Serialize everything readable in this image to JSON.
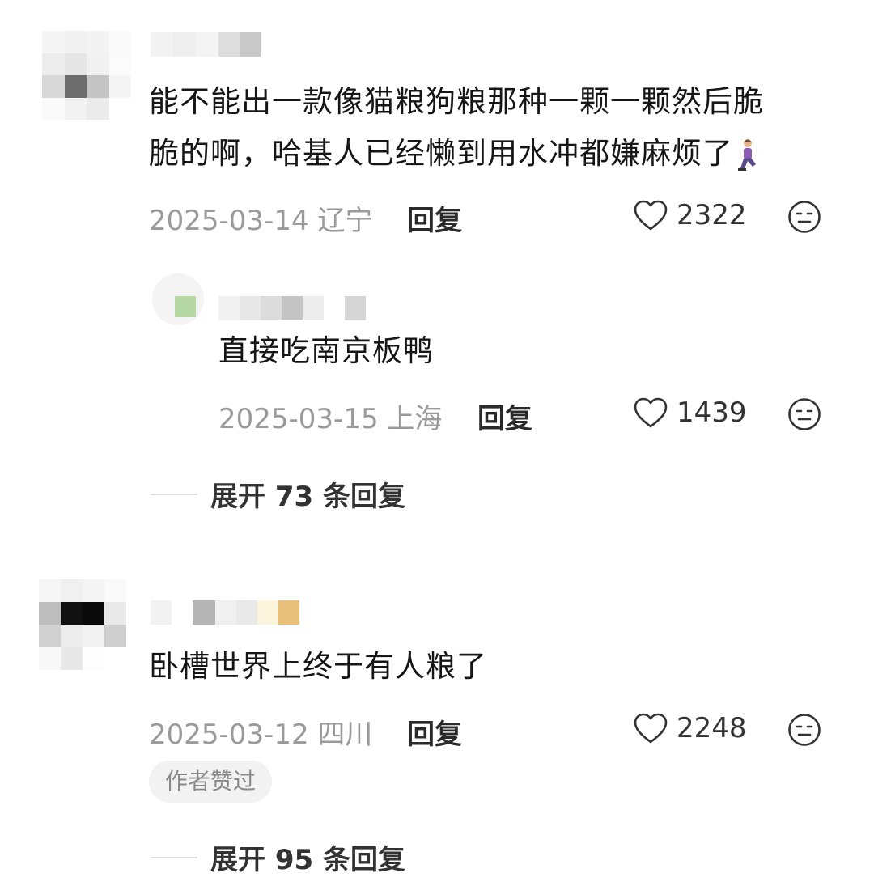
{
  "comments": [
    {
      "text_line1": "能不能出一款像猫粮狗粮那种一颗一颗然后脆",
      "text_line2": "脆的啊，哈基人已经懒到用水冲都嫌麻烦了",
      "emoji": "kneeling-person-emoji",
      "date": "2025-03-14",
      "location": "辽宁",
      "reply_label": "回复",
      "likes": "2322",
      "reply": {
        "text": "直接吃南京板鸭",
        "date": "2025-03-15",
        "location": "上海",
        "reply_label": "回复",
        "likes": "1439"
      },
      "expand_label": "展开 73 条回复"
    },
    {
      "text": "卧槽世界上终于有人粮了",
      "date": "2025-03-12",
      "location": "四川",
      "reply_label": "回复",
      "likes": "2248",
      "badge": "作者赞过",
      "expand_label": "展开 95 条回复"
    }
  ],
  "icons": {
    "like": "heart-outline-icon",
    "dislike": "unamused-face-icon"
  },
  "colors": {
    "text": "#161616",
    "meta": "#9a9a9a",
    "badge_bg": "#f2f2f2"
  }
}
